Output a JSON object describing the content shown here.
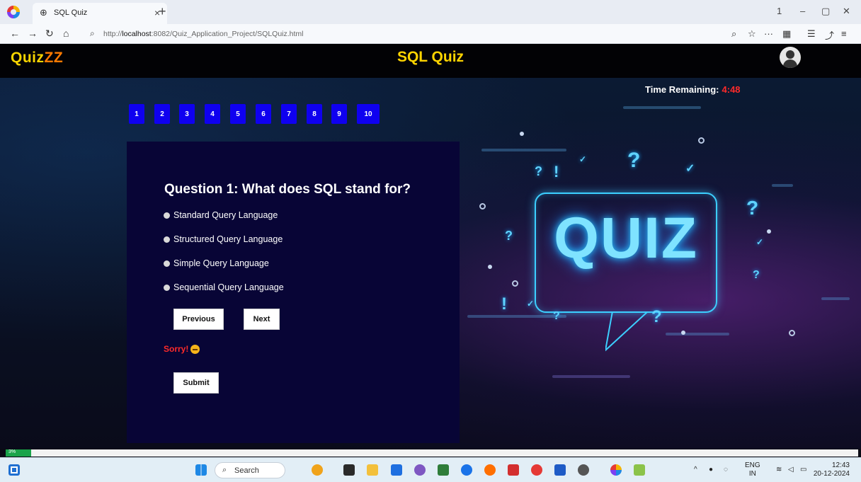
{
  "browser": {
    "tab_title": "SQL Quiz",
    "tab_close": "×",
    "new_tab": "+",
    "url_prefix": "http://",
    "url_host": "localhost",
    "url_rest": ":8082/Quiz_Application_Project/SQLQuiz.html",
    "window_minimize": "–",
    "window_restore": "▢",
    "window_close": "✕"
  },
  "header": {
    "brand_main": "Quiz",
    "brand_accent": "ZZ",
    "title": "SQL Quiz"
  },
  "timer": {
    "label": "Time Remaining:",
    "value": "4:48"
  },
  "question_nav": [
    "1",
    "2",
    "3",
    "4",
    "5",
    "6",
    "7",
    "8",
    "9",
    "10"
  ],
  "question": {
    "text": "Question 1: What does SQL stand for?",
    "options": [
      "Standard Query Language",
      "Structured Query Language",
      "Simple Query Language",
      "Sequential Query Language"
    ]
  },
  "buttons": {
    "previous": "Previous",
    "next": "Next",
    "submit": "Submit"
  },
  "feedback": "Sorry!",
  "illustration": {
    "text": "QUIZ"
  },
  "progress": {
    "label": "3%",
    "value": 0.03
  },
  "taskbar": {
    "search_placeholder": "Search",
    "lang_top": "ENG",
    "lang_bottom": "IN",
    "time": "12:43",
    "date": "20-12-2024"
  },
  "colors": {
    "accent_yellow": "#ffd400",
    "accent_orange": "#ff7a00",
    "question_button": "#0f00f0",
    "timer_value": "#ff2a2a",
    "card_bg": "#080536",
    "progress_fill": "#1aa34a"
  }
}
